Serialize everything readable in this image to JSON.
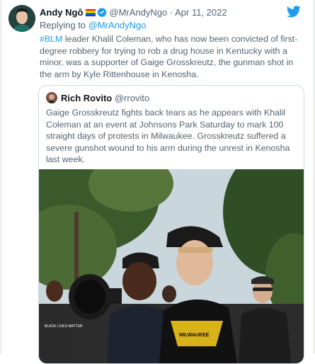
{
  "tweet": {
    "display_name": "Andy Ngô",
    "handle": "@MrAndyNgo",
    "separator": "·",
    "date": "Apr 11, 2022",
    "reply_prefix": "Replying to ",
    "reply_handle": "@MrAndyNgo",
    "hashtag": "#BLM",
    "body": " leader Khalil Coleman, who has now been convicted of first-degree robbery for trying to rob a drug house in Kentucky with a minor, was a supporter of Gaige Grosskreutz, the gunman shot in the arm by Kyle Rittenhouse in Kenosha."
  },
  "quote": {
    "display_name": "Rich Rovito",
    "handle": "@rrovito",
    "body": "Gaige Grosskreutz fights back tears as he appears with Khalil Coleman at an event at Johnsons Park Saturday to mark 100 straight days of protests in Milwaukee. Grosskreutz suffered a severe gunshot wound to his arm during the unrest in Kenosha last week."
  },
  "photo": {
    "shirt_text_left": "BLACK LIVES MATTER",
    "shirt_text_center": "MILWAUKEE"
  },
  "colors": {
    "accent": "#1d9bf0",
    "text": "#0f1419",
    "muted": "#536471",
    "border": "#cfd9de"
  },
  "icons": [
    "twitter-bird-icon",
    "verified-badge-icon",
    "rainbow-flag-icon"
  ]
}
